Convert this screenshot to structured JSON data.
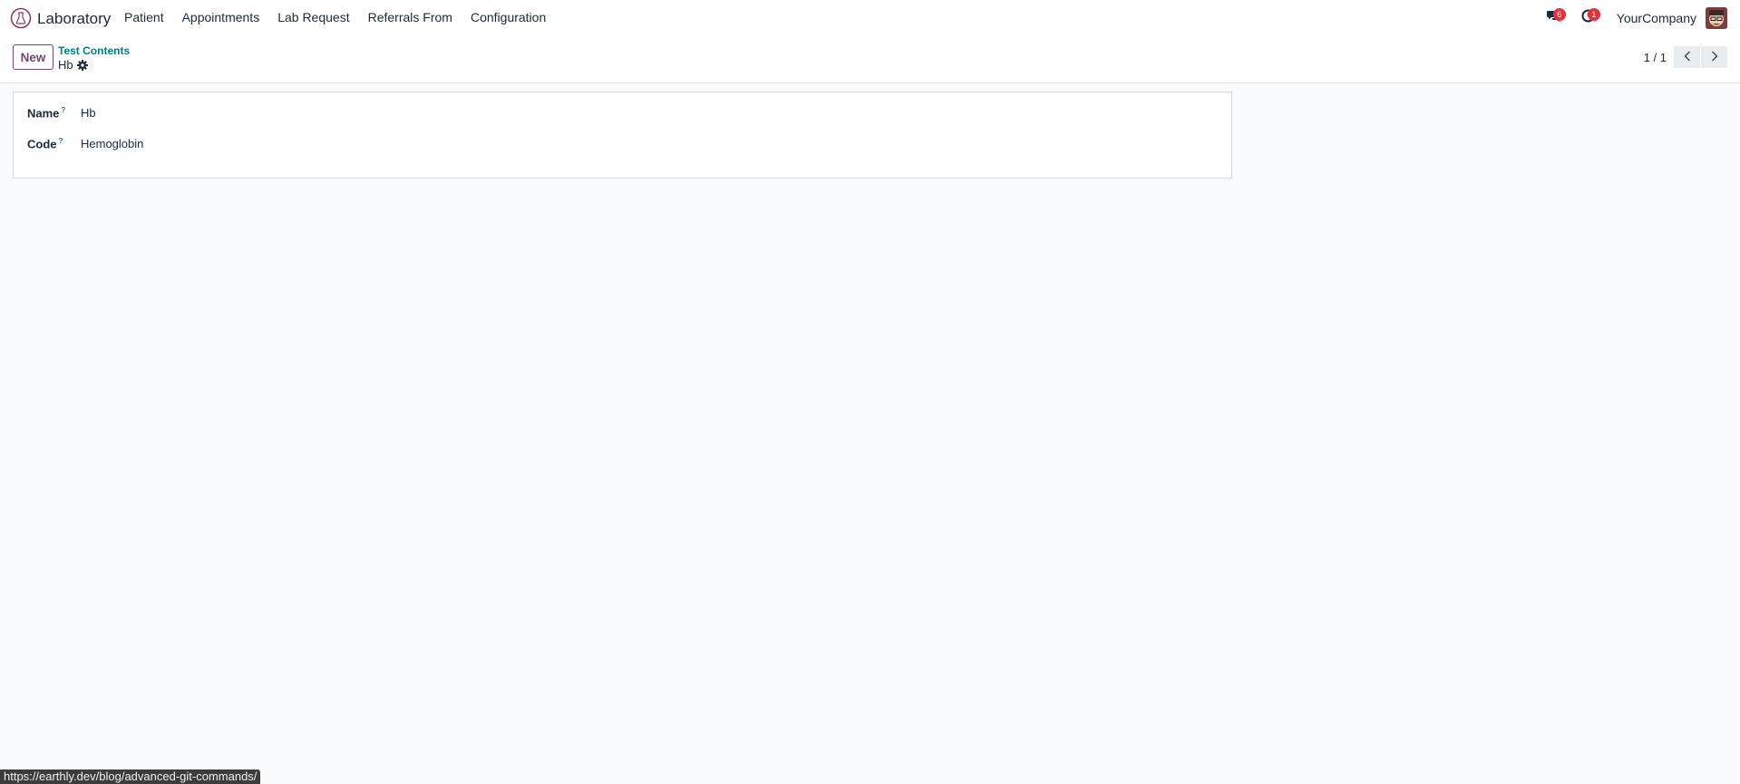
{
  "navbar": {
    "app_name": "Laboratory",
    "app_icon": "lab-flask-icon",
    "menu": [
      {
        "label": "Patient"
      },
      {
        "label": "Appointments"
      },
      {
        "label": "Lab Request"
      },
      {
        "label": "Referrals From"
      },
      {
        "label": "Configuration"
      }
    ],
    "messages_badge": "6",
    "activities_badge": "1",
    "company": "YourCompany",
    "accent_color": "#714b67",
    "badge_color": "#e6313a"
  },
  "control_panel": {
    "new_label": "New",
    "breadcrumb": "Test Contents",
    "record_title": "Hb",
    "pager_value": "1 / 1"
  },
  "form": {
    "fields": [
      {
        "label": "Name",
        "help": "?",
        "value": "Hb"
      },
      {
        "label": "Code",
        "help": "?",
        "value": "Hemoglobin"
      }
    ]
  },
  "status_bar": {
    "url": "https://earthly.dev/blog/advanced-git-commands/"
  }
}
